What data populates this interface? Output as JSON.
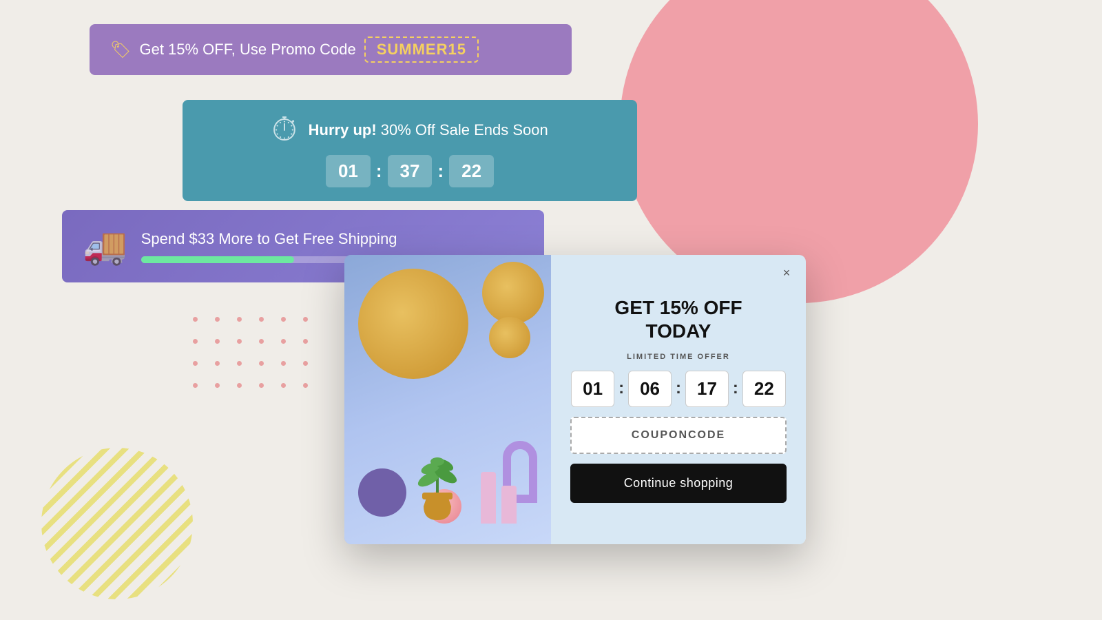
{
  "background": {
    "color": "#f0ede8"
  },
  "promo_banner": {
    "text": "Get 15% OFF, Use Promo Code",
    "code": "SUMMER15",
    "bg_color": "#9b7abf",
    "tag_icon": "🏷"
  },
  "countdown_banner": {
    "title_bold": "Hurry up!",
    "title_rest": " 30% Off Sale Ends Soon",
    "bg_color": "#4a9aad",
    "timer": {
      "hours": "01",
      "minutes": "37",
      "seconds": "22"
    }
  },
  "shipping_banner": {
    "text": "Spend $33 More to Get Free Shipping",
    "bg_color_start": "#7a6abf",
    "bg_color_end": "#8b7fd4",
    "progress_percent": 40
  },
  "popup": {
    "title_line1": "GET 15% OFF",
    "title_line2": "TODAY",
    "subtitle": "LIMITED TIME OFFER",
    "timer": {
      "hours": "01",
      "minutes": "06",
      "tens": "17",
      "seconds": "22"
    },
    "coupon_placeholder": "COUPONCODE",
    "cta_label": "Continue shopping",
    "close_icon": "×"
  }
}
